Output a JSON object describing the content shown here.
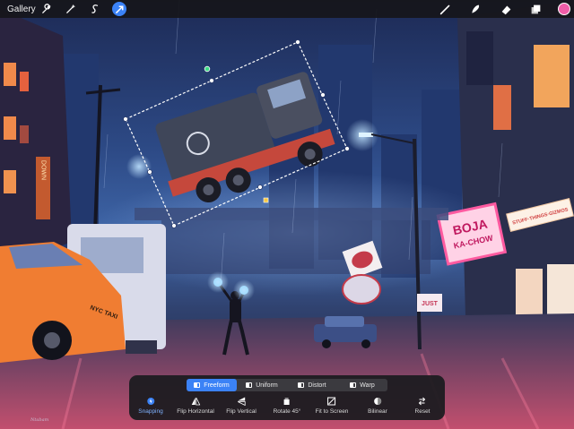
{
  "app": {
    "gallery_label": "Gallery",
    "accent_color": "#3b82f6",
    "current_color": "#ef5da8"
  },
  "toolbar_left": [
    {
      "icon": "wrench-icon"
    },
    {
      "icon": "magic-wand-icon"
    },
    {
      "icon": "selection-s-icon"
    },
    {
      "icon": "transform-arrow-icon",
      "active": true
    }
  ],
  "toolbar_right": [
    {
      "icon": "brush-icon"
    },
    {
      "icon": "smudge-icon"
    },
    {
      "icon": "eraser-icon"
    },
    {
      "icon": "layers-icon"
    }
  ],
  "transform": {
    "modes": [
      {
        "label": "Freeform",
        "active": true
      },
      {
        "label": "Uniform",
        "active": false
      },
      {
        "label": "Distort",
        "active": false
      },
      {
        "label": "Warp",
        "active": false
      }
    ],
    "actions": [
      {
        "label": "Snapping",
        "icon": "snapping-icon",
        "on": true
      },
      {
        "label": "Flip Horizontal",
        "icon": "flip-horizontal-icon"
      },
      {
        "label": "Flip Vertical",
        "icon": "flip-vertical-icon"
      },
      {
        "label": "Rotate 45°",
        "icon": "rotate-icon"
      },
      {
        "label": "Fit to Screen",
        "icon": "fit-to-screen-icon"
      },
      {
        "label": "Bilinear",
        "icon": "bilinear-icon"
      },
      {
        "label": "Reset",
        "icon": "reset-icon"
      }
    ]
  },
  "artwork": {
    "signs": {
      "boja_line1": "BOJA",
      "boja_line2": "KA-CHOW",
      "stuff_sign": "STUFF·THINGS·GIZMOS",
      "down_sign": "DOWN",
      "just_sign": "JUST",
      "taxi_text": "NYC TAXI"
    },
    "signature": "Ntabam"
  }
}
